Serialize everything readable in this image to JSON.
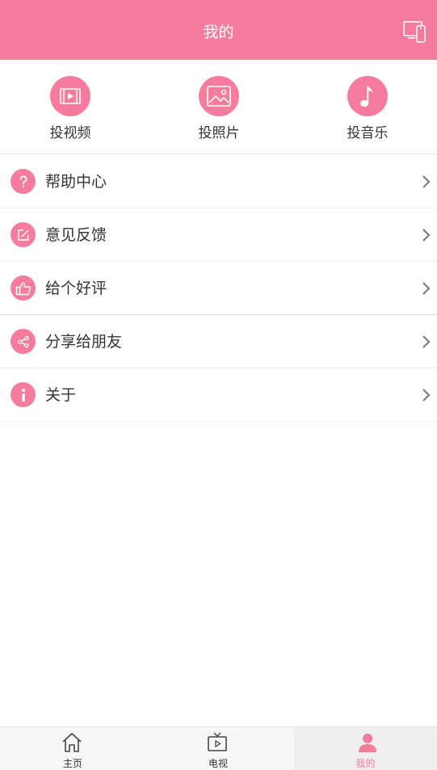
{
  "header": {
    "title": "我的",
    "action_icon": "screen-cast-device-icon"
  },
  "cast_options": [
    {
      "label": "投视频",
      "icon": "video-icon"
    },
    {
      "label": "投照片",
      "icon": "image-icon"
    },
    {
      "label": "投音乐",
      "icon": "music-note-icon"
    }
  ],
  "menu": [
    {
      "label": "帮助中心",
      "icon": "question-icon"
    },
    {
      "label": "意见反馈",
      "icon": "edit-icon"
    },
    {
      "label": "给个好评",
      "icon": "thumbs-up-icon"
    },
    {
      "label": "分享给朋友",
      "icon": "share-icon"
    },
    {
      "label": "关于",
      "icon": "info-icon"
    }
  ],
  "tabbar": {
    "tabs": [
      {
        "label": "主页",
        "icon": "home-icon"
      },
      {
        "label": "电视",
        "icon": "tv-icon"
      },
      {
        "label": "我的",
        "icon": "user-icon",
        "active": true
      }
    ]
  },
  "colors": {
    "accent": "#f67c9d",
    "text": "#333333",
    "tabbar_bg": "#f7f7f7"
  }
}
